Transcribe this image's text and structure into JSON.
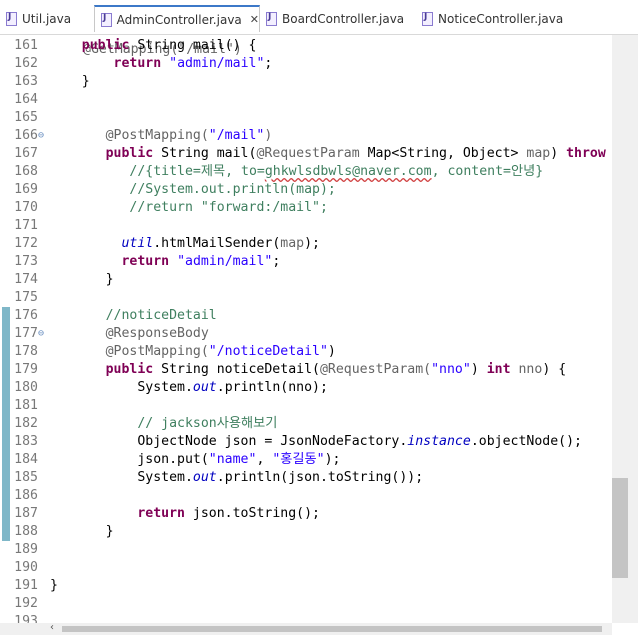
{
  "tabs": [
    {
      "label": "Util.java",
      "active": false
    },
    {
      "label": "AdminController.java",
      "active": true,
      "closable": true
    },
    {
      "label": "BoardController.java",
      "active": false
    },
    {
      "label": "NoticeController.java",
      "active": false
    }
  ],
  "editor": {
    "partial_top_line": "@GetMapping(\"/mail\")",
    "lines": [
      {
        "n": "161",
        "seg": [
          [
            "    ",
            ""
          ],
          [
            "public",
            "kw"
          ],
          [
            " String mail() {",
            ""
          ]
        ]
      },
      {
        "n": "162",
        "seg": [
          [
            "        ",
            ""
          ],
          [
            "return",
            "kw"
          ],
          [
            " ",
            ""
          ],
          [
            "\"admin/mail\"",
            "str"
          ],
          [
            ";",
            ""
          ]
        ]
      },
      {
        "n": "163",
        "seg": [
          [
            "    }",
            ""
          ]
        ]
      },
      {
        "n": "164",
        "seg": []
      },
      {
        "n": "165",
        "seg": []
      },
      {
        "n": "166",
        "fold": true,
        "seg": [
          [
            "       ",
            ""
          ],
          [
            "@PostMapping(",
            "an"
          ],
          [
            "\"/mail\"",
            "str"
          ],
          [
            ")",
            "an"
          ]
        ]
      },
      {
        "n": "167",
        "seg": [
          [
            "       ",
            ""
          ],
          [
            "public",
            "kw"
          ],
          [
            " String mail(",
            ""
          ],
          [
            "@RequestParam",
            "an"
          ],
          [
            " Map<String, Object> ",
            ""
          ],
          [
            "map",
            "an"
          ],
          [
            ") ",
            ""
          ],
          [
            "throw",
            "kw"
          ]
        ]
      },
      {
        "n": "168",
        "seg": [
          [
            "          ",
            ""
          ],
          [
            "//{title=제목, to=",
            "cm"
          ],
          [
            "ghkwlsdbwls@naver.com",
            "cm sq"
          ],
          [
            ", content=안녕}",
            "cm"
          ]
        ]
      },
      {
        "n": "169",
        "seg": [
          [
            "          ",
            ""
          ],
          [
            "//System.out.println(map);",
            "cm"
          ]
        ]
      },
      {
        "n": "170",
        "seg": [
          [
            "          ",
            ""
          ],
          [
            "//return \"forward:/mail\";",
            "cm"
          ]
        ]
      },
      {
        "n": "171",
        "seg": []
      },
      {
        "n": "172",
        "seg": [
          [
            "         ",
            ""
          ],
          [
            "util",
            "fld"
          ],
          [
            ".htmlMailSender(",
            ""
          ],
          [
            "map",
            "an"
          ],
          [
            ");",
            ""
          ]
        ]
      },
      {
        "n": "173",
        "seg": [
          [
            "         ",
            ""
          ],
          [
            "return",
            "kw"
          ],
          [
            " ",
            ""
          ],
          [
            "\"admin/mail\"",
            "str"
          ],
          [
            ";",
            ""
          ]
        ]
      },
      {
        "n": "174",
        "seg": [
          [
            "       }",
            ""
          ]
        ]
      },
      {
        "n": "175",
        "seg": []
      },
      {
        "n": "176",
        "mark": true,
        "seg": [
          [
            "       ",
            ""
          ],
          [
            "//noticeDetail",
            "cm"
          ]
        ]
      },
      {
        "n": "177",
        "mark": true,
        "fold": true,
        "seg": [
          [
            "       ",
            ""
          ],
          [
            "@ResponseBody",
            "an"
          ]
        ]
      },
      {
        "n": "178",
        "mark": true,
        "seg": [
          [
            "       ",
            ""
          ],
          [
            "@PostMapping(",
            "an"
          ],
          [
            "\"/noticeDetail\"",
            "str"
          ],
          [
            ")",
            ""
          ]
        ]
      },
      {
        "n": "179",
        "mark": true,
        "seg": [
          [
            "       ",
            ""
          ],
          [
            "public",
            "kw"
          ],
          [
            " String noticeDetail(",
            ""
          ],
          [
            "@RequestParam(",
            "an"
          ],
          [
            "\"nno\"",
            "str"
          ],
          [
            ") ",
            ""
          ],
          [
            "int",
            "kw"
          ],
          [
            " ",
            ""
          ],
          [
            "nno",
            "an"
          ],
          [
            ") {",
            ""
          ]
        ]
      },
      {
        "n": "180",
        "mark": true,
        "seg": [
          [
            "           System.",
            ""
          ],
          [
            "out",
            "fld"
          ],
          [
            ".println(nno);",
            ""
          ]
        ]
      },
      {
        "n": "181",
        "mark": true,
        "seg": []
      },
      {
        "n": "182",
        "mark": true,
        "seg": [
          [
            "           ",
            ""
          ],
          [
            "// jackson사용해보기",
            "cm"
          ]
        ]
      },
      {
        "n": "183",
        "mark": true,
        "seg": [
          [
            "           ObjectNode json = JsonNodeFactory.",
            ""
          ],
          [
            "instance",
            "fld"
          ],
          [
            ".objectNode();",
            ""
          ]
        ]
      },
      {
        "n": "184",
        "mark": true,
        "seg": [
          [
            "           json.put(",
            ""
          ],
          [
            "\"name\"",
            "str"
          ],
          [
            ", ",
            ""
          ],
          [
            "\"홍길동\"",
            "str"
          ],
          [
            ");",
            ""
          ]
        ]
      },
      {
        "n": "185",
        "mark": true,
        "seg": [
          [
            "           System.",
            ""
          ],
          [
            "out",
            "fld"
          ],
          [
            ".println(json.toString());",
            ""
          ]
        ]
      },
      {
        "n": "186",
        "mark": true,
        "seg": []
      },
      {
        "n": "187",
        "mark": true,
        "seg": [
          [
            "           ",
            ""
          ],
          [
            "return",
            "kw"
          ],
          [
            " json.toString();",
            ""
          ]
        ]
      },
      {
        "n": "188",
        "mark": true,
        "seg": [
          [
            "       }",
            ""
          ]
        ]
      },
      {
        "n": "189",
        "seg": []
      },
      {
        "n": "190",
        "seg": []
      },
      {
        "n": "191",
        "seg": [
          [
            "}",
            ""
          ]
        ]
      },
      {
        "n": "192",
        "seg": []
      },
      {
        "n": "193",
        "seg": []
      }
    ]
  },
  "scrollbar": {
    "vertical_position": 0.85,
    "vertical_thumb_fraction": 0.17
  },
  "colors": {
    "keyword": "#7f0055",
    "string": "#2a00ff",
    "comment": "#3f7f5f",
    "annotation": "#646464",
    "field": "#0000c0",
    "active_tab_accent": "#3c78c8"
  }
}
